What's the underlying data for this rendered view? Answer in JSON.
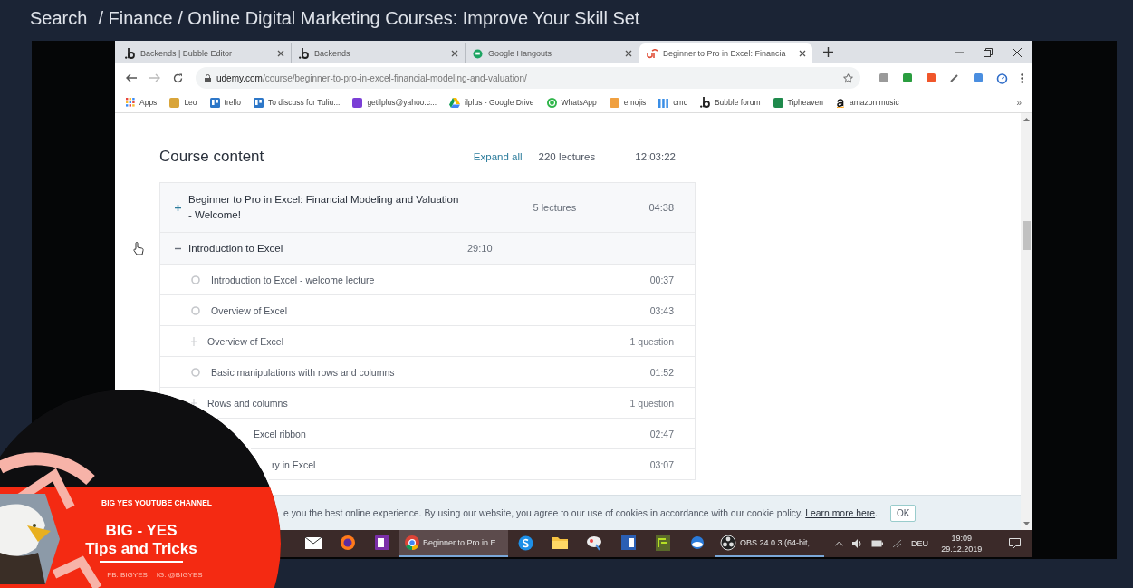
{
  "header": {
    "search": "Search",
    "breadcrumb": "/ Finance / Online Digital Marketing Courses: Improve Your Skill Set"
  },
  "browser": {
    "tabs": [
      {
        "title": "Backends | Bubble Editor",
        "kind": "bubble",
        "selected": false
      },
      {
        "title": "Backends",
        "kind": "bubble",
        "selected": false
      },
      {
        "title": "Google Hangouts",
        "kind": "hangouts",
        "selected": false
      },
      {
        "title": "Beginner to Pro in Excel: Financia",
        "kind": "udemy",
        "selected": true
      }
    ],
    "address": {
      "domain": "udemy.com",
      "path": "/course/beginner-to-pro-in-excel-financial-modeling-and-valuation/"
    },
    "bookmarks": [
      {
        "label": "Apps",
        "kind": "grid"
      },
      {
        "label": "Leo",
        "kind": "square",
        "color": "#d9a53a"
      },
      {
        "label": "trello",
        "kind": "trello",
        "color": "#2d77c8"
      },
      {
        "label": "To discuss for Tuliu...",
        "kind": "trello",
        "color": "#2d77c8"
      },
      {
        "label": "getilplus@yahoo.c...",
        "kind": "square",
        "color": "#7b3fd6"
      },
      {
        "label": "ilplus - Google Drive",
        "kind": "drive"
      },
      {
        "label": "WhatsApp",
        "kind": "round",
        "color": "#2fb54a"
      },
      {
        "label": "emojis",
        "kind": "square",
        "color": "#f0a040"
      },
      {
        "label": "cmc",
        "kind": "bars",
        "color": "#3a8ee6"
      },
      {
        "label": "Bubble forum",
        "kind": "bubble"
      },
      {
        "label": "Tipheaven",
        "kind": "square",
        "color": "#1f8a4c"
      },
      {
        "label": "amazon music",
        "kind": "amazon"
      }
    ],
    "more": "»"
  },
  "course": {
    "title": "Course content",
    "expand_all": "Expand all",
    "lectures": "220 lectures",
    "duration": "12:03:22",
    "sections": [
      {
        "title": "Beginner to Pro in Excel: Financial Modeling and Valuation - Welcome!",
        "count": "5 lectures",
        "duration": "04:38",
        "expanded": false
      },
      {
        "title": "Introduction to Excel",
        "duration": "29:10",
        "expanded": true,
        "items": [
          {
            "kind": "lecture",
            "title": "Introduction to Excel - welcome lecture",
            "meta": "00:37",
            "cut": false
          },
          {
            "kind": "lecture",
            "title": "Overview of Excel",
            "meta": "03:43",
            "cut": false
          },
          {
            "kind": "quiz",
            "title": "Overview of Excel",
            "meta": "1 question",
            "cut": false
          },
          {
            "kind": "lecture",
            "title": "Basic manipulations with rows and columns",
            "meta": "01:52",
            "cut": false
          },
          {
            "kind": "quiz",
            "title": "Rows and columns",
            "meta": "1 question",
            "cut": false
          },
          {
            "kind": "lecture",
            "title": "Excel ribbon",
            "meta": "02:47",
            "cut": true
          },
          {
            "kind": "lecture",
            "title": "ry in Excel",
            "meta": "03:07",
            "cut": true
          }
        ]
      }
    ]
  },
  "cookie": {
    "text": "e you the best online experience. By using our website, you agree to our use of cookies in accordance with our cookie policy.",
    "link": "Learn more here",
    "after": ".",
    "button": "OK"
  },
  "taskbar": {
    "apps": [
      {
        "kind": "mail",
        "selected": false,
        "running": false
      },
      {
        "kind": "firefox",
        "selected": false,
        "running": false
      },
      {
        "kind": "onenote",
        "selected": false,
        "running": false
      },
      {
        "kind": "chrome",
        "label": "Beginner to Pro in E...",
        "selected": true,
        "running": true
      },
      {
        "kind": "skype",
        "selected": false,
        "running": false
      },
      {
        "kind": "folder",
        "selected": false,
        "running": false
      },
      {
        "kind": "paint",
        "selected": false,
        "running": false
      },
      {
        "kind": "word",
        "selected": false,
        "running": false
      },
      {
        "kind": "green",
        "selected": false,
        "running": false
      },
      {
        "kind": "cloud",
        "selected": false,
        "running": false
      },
      {
        "kind": "obs",
        "label": "OBS 24.0.3 (64-bit, ...",
        "selected": false,
        "running": true
      }
    ],
    "language": "DEU",
    "time": "19:09",
    "date": "29.12.2019"
  },
  "overlay": {
    "channel": "BIG YES YOUTUBE CHANNEL",
    "name": "BIG - YES",
    "tagline": "Tips and Tricks",
    "fb": "FB: BIGYES",
    "ig": "IG: @BIGYES"
  }
}
